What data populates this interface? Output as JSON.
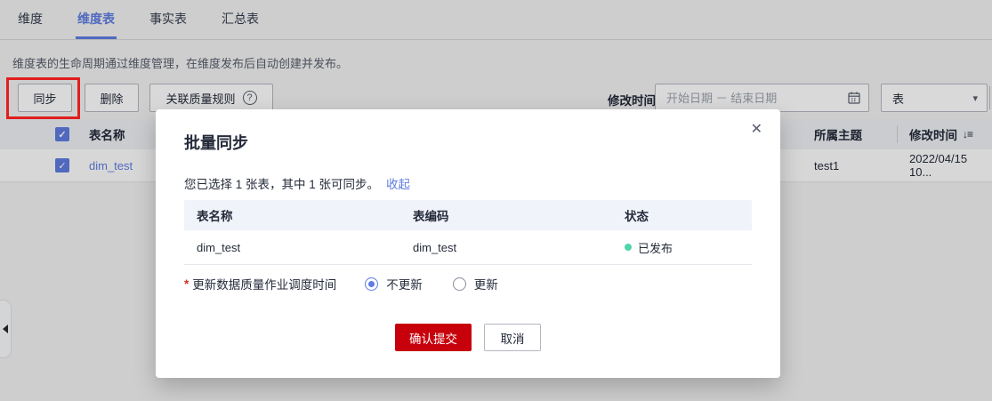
{
  "tabs": {
    "items": [
      {
        "label": "维度"
      },
      {
        "label": "维度表"
      },
      {
        "label": "事实表"
      },
      {
        "label": "汇总表"
      }
    ]
  },
  "description": "维度表的生命周期通过维度管理，在维度发布后自动创建并发布。",
  "toolbar": {
    "sync_label": "同步",
    "delete_label": "删除",
    "quality_rule_label": "关联质量规则",
    "modified_time_label": "修改时间",
    "date_range_placeholder": "开始日期 － 结束日期",
    "type_filter_value": "表"
  },
  "table": {
    "header_name": "表名称",
    "header_subject": "所属主题",
    "header_modified": "修改时间",
    "row": {
      "name": "dim_test",
      "subject": "test1",
      "modified": "2022/04/15 10..."
    }
  },
  "modal": {
    "title": "批量同步",
    "summary": "您已选择 1 张表，其中 1 张可同步。",
    "collapse_link": "收起",
    "table": {
      "header_name": "表名称",
      "header_code": "表编码",
      "header_status": "状态",
      "row": {
        "name": "dim_test",
        "code": "dim_test",
        "status": "已发布"
      }
    },
    "form": {
      "required_mark": "*",
      "label": "更新数据质量作业调度时间",
      "option_no_update": "不更新",
      "option_update": "更新"
    },
    "confirm_label": "确认提交",
    "cancel_label": "取消"
  },
  "icons": {
    "close": "✕",
    "caret": "▾",
    "question": "?",
    "check": "✓",
    "sort": "↓≡"
  },
  "colors": {
    "accent": "#5e7ce0",
    "danger": "#c7000b",
    "success": "#50d4ab",
    "annotation": "#e11e1e"
  }
}
